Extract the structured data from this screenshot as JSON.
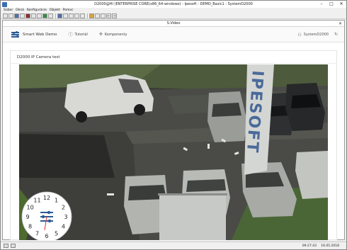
{
  "window": {
    "title": "D2000@HI (ENTERPRISE CORE(x86_64-windows) - Ipesoft - DEMO_Basic1 - SystemD2000",
    "min": "–",
    "max": "□",
    "close": "✕"
  },
  "menu": [
    "Súbor",
    "Okná",
    "Konfigurácie",
    "Objekt",
    "Pomoc"
  ],
  "inner_window": {
    "title": "S.Video",
    "close": "✕"
  },
  "app": {
    "brand": "Smart Web Demo",
    "nav": [
      {
        "label": "Tutoriál",
        "icon": "info-icon"
      },
      {
        "label": "Komponenty",
        "icon": "components-icon"
      }
    ],
    "user": "SystemD2000",
    "logout_icon": "refresh-icon"
  },
  "card": {
    "title": "D2000 IP Camera test"
  },
  "camera": {
    "banner_text": "IPESOFT"
  },
  "clock": {
    "numbers": [
      "12",
      "1",
      "2",
      "3",
      "4",
      "5",
      "6",
      "7",
      "8",
      "9",
      "10",
      "11"
    ]
  },
  "status": {
    "time": "09:27:43",
    "date": "16.05.2018"
  }
}
